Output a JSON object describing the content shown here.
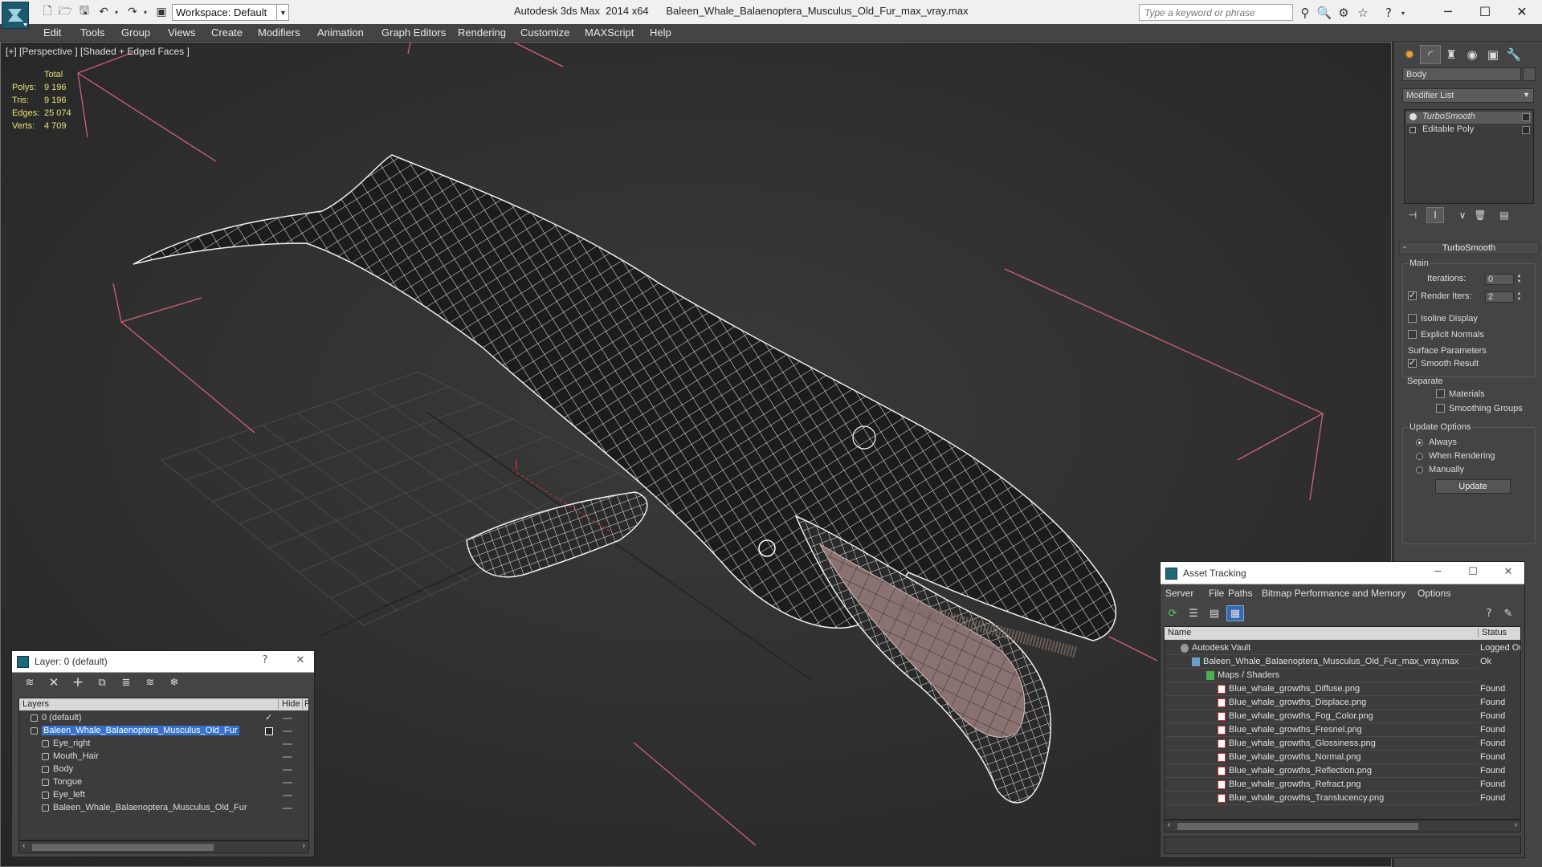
{
  "titlebar": {
    "workspace": "Workspace: Default",
    "app_title": "Autodesk 3ds Max  2014 x64",
    "file_title": "Baleen_Whale_Balaenoptera_Musculus_Old_Fur_max_vray.max",
    "search_placeholder": "Type a keyword or phrase"
  },
  "menu": [
    "Edit",
    "Tools",
    "Group",
    "Views",
    "Create",
    "Modifiers",
    "Animation",
    "Graph Editors",
    "Rendering",
    "Customize",
    "MAXScript",
    "Help"
  ],
  "viewport": {
    "label": "[+] [Perspective ] [Shaded + Edged Faces ]",
    "stats": {
      "header": "Total",
      "rows": [
        {
          "label": "Polys:",
          "value": "9 196"
        },
        {
          "label": "Tris:",
          "value": "9 196"
        },
        {
          "label": "Edges:",
          "value": "25 074"
        },
        {
          "label": "Verts:",
          "value": "4 709"
        }
      ]
    }
  },
  "command_panel": {
    "object_name": "Body",
    "modifier_list": "Modifier List",
    "stack": [
      "TurboSmooth",
      "Editable Poly"
    ],
    "rollout_title": "TurboSmooth",
    "main_group": "Main",
    "iterations_label": "Iterations:",
    "iterations_value": "0",
    "render_iters_label": "Render Iters:",
    "render_iters_value": "2",
    "render_iters_checked": true,
    "isoline_label": "Isoline Display",
    "explicit_normals_label": "Explicit Normals",
    "surface_group": "Surface Parameters",
    "smooth_result_label": "Smooth Result",
    "separate_label": "Separate",
    "materials_label": "Materials",
    "smoothing_groups_label": "Smoothing Groups",
    "update_group": "Update Options",
    "always_label": "Always",
    "when_rendering_label": "When Rendering",
    "manually_label": "Manually",
    "update_button": "Update"
  },
  "layer_dialog": {
    "title": "Layer: 0 (default)",
    "help": "?",
    "columns": {
      "layers": "Layers",
      "hide": "Hide",
      "freeze": "F"
    },
    "rows": [
      {
        "name": "0 (default)",
        "indent": 1,
        "check": true,
        "selected": false
      },
      {
        "name": "Baleen_Whale_Balaenoptera_Musculus_Old_Fur",
        "indent": 1,
        "check": false,
        "selected": true
      },
      {
        "name": "Eye_right",
        "indent": 2,
        "check": false,
        "selected": false
      },
      {
        "name": "Mouth_Hair",
        "indent": 2,
        "check": false,
        "selected": false
      },
      {
        "name": "Body",
        "indent": 2,
        "check": false,
        "selected": false
      },
      {
        "name": "Tongue",
        "indent": 2,
        "check": false,
        "selected": false
      },
      {
        "name": "Eye_left",
        "indent": 2,
        "check": false,
        "selected": false
      },
      {
        "name": "Baleen_Whale_Balaenoptera_Musculus_Old_Fur",
        "indent": 2,
        "check": false,
        "selected": false
      }
    ]
  },
  "asset_tracking": {
    "title": "Asset Tracking",
    "menu": [
      "Server",
      "File",
      "Paths",
      "Bitmap Performance and Memory",
      "Options"
    ],
    "columns": {
      "name": "Name",
      "status": "Status"
    },
    "rows": [
      {
        "name": "Autodesk Vault",
        "status": "Logged Ou",
        "indent": 1,
        "icon": "vault"
      },
      {
        "name": "Baleen_Whale_Balaenoptera_Musculus_Old_Fur_max_vray.max",
        "status": "Ok",
        "indent": 2,
        "icon": "max"
      },
      {
        "name": "Maps / Shaders",
        "status": "",
        "indent": 3,
        "icon": "folder"
      },
      {
        "name": "Blue_whale_growths_Diffuse.png",
        "status": "Found",
        "indent": 4,
        "icon": "png"
      },
      {
        "name": "Blue_whale_growths_Displace.png",
        "status": "Found",
        "indent": 4,
        "icon": "png"
      },
      {
        "name": "Blue_whale_growths_Fog_Color.png",
        "status": "Found",
        "indent": 4,
        "icon": "png"
      },
      {
        "name": "Blue_whale_growths_Fresnel.png",
        "status": "Found",
        "indent": 4,
        "icon": "png"
      },
      {
        "name": "Blue_whale_growths_Glossiness.png",
        "status": "Found",
        "indent": 4,
        "icon": "png"
      },
      {
        "name": "Blue_whale_growths_Normal.png",
        "status": "Found",
        "indent": 4,
        "icon": "png"
      },
      {
        "name": "Blue_whale_growths_Reflection.png",
        "status": "Found",
        "indent": 4,
        "icon": "png"
      },
      {
        "name": "Blue_whale_growths_Refract.png",
        "status": "Found",
        "indent": 4,
        "icon": "png"
      },
      {
        "name": "Blue_whale_growths_Translucency.png",
        "status": "Found",
        "indent": 4,
        "icon": "png"
      }
    ]
  }
}
